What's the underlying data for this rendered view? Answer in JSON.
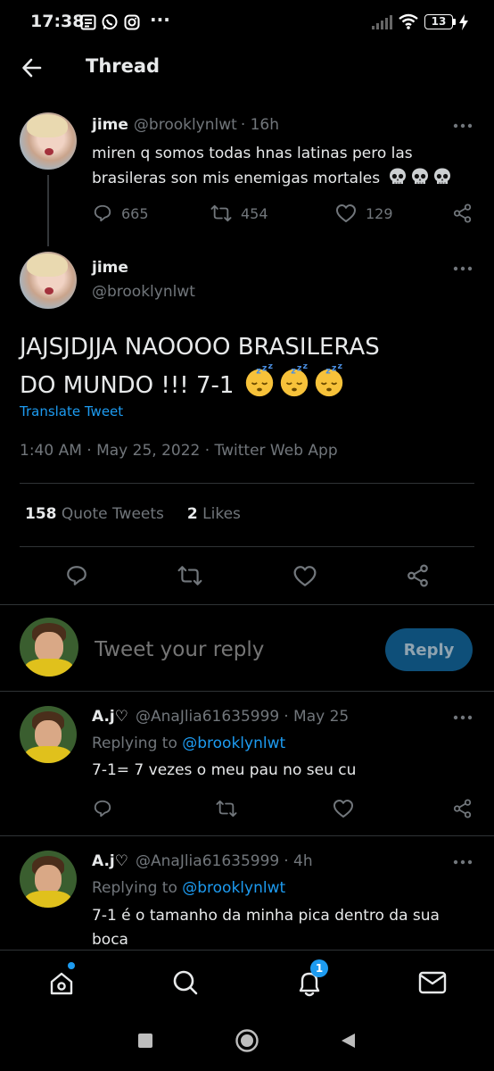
{
  "status_bar": {
    "time": "17:38",
    "battery": "13",
    "more": "···"
  },
  "header": {
    "title": "Thread"
  },
  "parent_tweet": {
    "name": "jime",
    "handle": "@brooklynlwt",
    "time": "· 16h",
    "text": "miren q somos todas hnas latinas pero las brasileras son mis enemigas mortales",
    "emoji_icons": [
      "skull-emoji",
      "skull-emoji",
      "skull-emoji"
    ],
    "replies": "665",
    "retweets": "454",
    "likes": "129"
  },
  "main_tweet": {
    "name": "jime",
    "handle": "@brooklynlwt",
    "text_line1": "JAJSJDJJA NAOOOO BRASILERAS",
    "text_line2": "DO MUNDO !!! 7-1",
    "emoji_icons": [
      "sleeping-face-emoji",
      "sleeping-face-emoji",
      "sleeping-face-emoji"
    ],
    "translate": "Translate Tweet",
    "meta": "1:40 AM · May 25, 2022 · Twitter Web App",
    "quote_count": "158",
    "quote_label": "Quote Tweets",
    "likes_count": "2",
    "likes_label": "Likes"
  },
  "compose": {
    "placeholder": "Tweet your reply",
    "button": "Reply"
  },
  "replies": [
    {
      "name": "A.j♡",
      "handle": "@AnaJlia61635999",
      "time": "· May 25",
      "replying_label": "Replying to",
      "replying_to": "@brooklynlwt",
      "text": "7-1= 7 vezes o meu pau no seu cu"
    },
    {
      "name": "A.j♡",
      "handle": "@AnaJlia61635999",
      "time": "· 4h",
      "replying_label": "Replying to",
      "replying_to": "@brooklynlwt",
      "text_line1": "7-1 é o tamanho da minha pica dentro da sua",
      "text_line2": "boca"
    }
  ],
  "bottom_nav": {
    "notification_badge": "1"
  },
  "colors": {
    "background": "#000000",
    "text": "#e7e9ea",
    "secondary": "#71767b",
    "accent": "#1d9bf0",
    "reply_button_bg": "#0e4f79",
    "divider": "#2f3336"
  }
}
